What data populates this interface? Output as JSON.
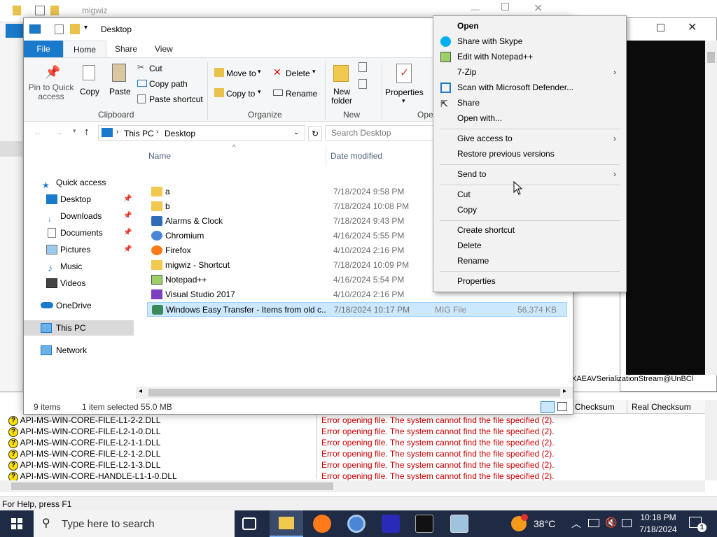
{
  "background_window": {
    "title": "migwiz"
  },
  "dependencies": {
    "headers": [
      "Checksum",
      "Real Checksum"
    ],
    "rows": [
      {
        "module": "API-MS-WIN-CORE-FILE-L1-2-2.DLL",
        "error": "Error opening file. The system cannot find the file specified (2)."
      },
      {
        "module": "API-MS-WIN-CORE-FILE-L2-1-0.DLL",
        "error": "Error opening file. The system cannot find the file specified (2)."
      },
      {
        "module": "API-MS-WIN-CORE-FILE-L2-1-1.DLL",
        "error": "Error opening file. The system cannot find the file specified (2)."
      },
      {
        "module": "API-MS-WIN-CORE-FILE-L2-1-2.DLL",
        "error": "Error opening file. The system cannot find the file specified (2)."
      },
      {
        "module": "API-MS-WIN-CORE-FILE-L2-1-3.DLL",
        "error": "Error opening file. The system cannot find the file specified (2)."
      },
      {
        "module": "API-MS-WIN-CORE-HANDLE-L1-1-0.DLL",
        "error": "Error opening file. The system cannot find the file specified (2)."
      }
    ],
    "console_tail": "XAEAVSerializationStream@UnBCl",
    "help": "For Help, press F1"
  },
  "explorer": {
    "title": "Desktop",
    "tabs": [
      "File",
      "Home",
      "Share",
      "View"
    ],
    "ribbon": {
      "pin": "Pin to Quick access",
      "copy": "Copy",
      "paste": "Paste",
      "cut": "Cut",
      "copy_path": "Copy path",
      "paste_shortcut": "Paste shortcut",
      "clipboard": "Clipboard",
      "move_to": "Move to",
      "copy_to": "Copy to",
      "delete": "Delete",
      "rename": "Rename",
      "organize": "Organize",
      "new_folder": "New folder",
      "new": "New",
      "properties": "Properties",
      "open_group": "Ope"
    },
    "address": {
      "this_pc": "This PC",
      "desktop": "Desktop"
    },
    "search_placeholder": "Search Desktop",
    "nav": [
      "Quick access",
      "Desktop",
      "Downloads",
      "Documents",
      "Pictures",
      "Music",
      "Videos",
      "OneDrive",
      "This PC",
      "Network"
    ],
    "columns": {
      "name": "Name",
      "date": "Date modified"
    },
    "files": [
      {
        "name": "a",
        "date": "7/18/2024 9:58 PM"
      },
      {
        "name": "b",
        "date": "7/18/2024 10:08 PM"
      },
      {
        "name": "Alarms & Clock",
        "date": "7/18/2024 9:43 PM"
      },
      {
        "name": "Chromium",
        "date": "4/16/2024 5:55 PM"
      },
      {
        "name": "Firefox",
        "date": "4/10/2024 2:16 PM"
      },
      {
        "name": "migwiz - Shortcut",
        "date": "7/18/2024 10:09 PM"
      },
      {
        "name": "Notepad++",
        "date": "4/16/2024 5:54 PM"
      },
      {
        "name": "Visual Studio 2017",
        "date": "4/10/2024 2:16 PM"
      },
      {
        "name": "Windows Easy Transfer - Items from old c...",
        "date": "7/18/2024 10:17 PM"
      }
    ],
    "selected_extra": {
      "type": "MIG File",
      "size": "56,374 KB"
    },
    "status": {
      "items": "9 items",
      "selected": "1 item selected  55.0 MB"
    }
  },
  "context_menu": {
    "items": [
      "Open",
      "Share with Skype",
      "Edit with Notepad++",
      "7-Zip",
      "Scan with Microsoft Defender...",
      "Share",
      "Open with...",
      "Give access to",
      "Restore previous versions",
      "Send to",
      "Cut",
      "Copy",
      "Create shortcut",
      "Delete",
      "Rename",
      "Properties"
    ]
  },
  "taskbar": {
    "search_placeholder": "Type here to search",
    "temperature": "38°C",
    "time": "10:18 PM",
    "date": "7/18/2024",
    "notification_count": "1"
  },
  "colors": {
    "accent": "#1979ca",
    "error": "#cc0000",
    "taskbar": "#1f2a44",
    "selection": "#cce8ff"
  }
}
